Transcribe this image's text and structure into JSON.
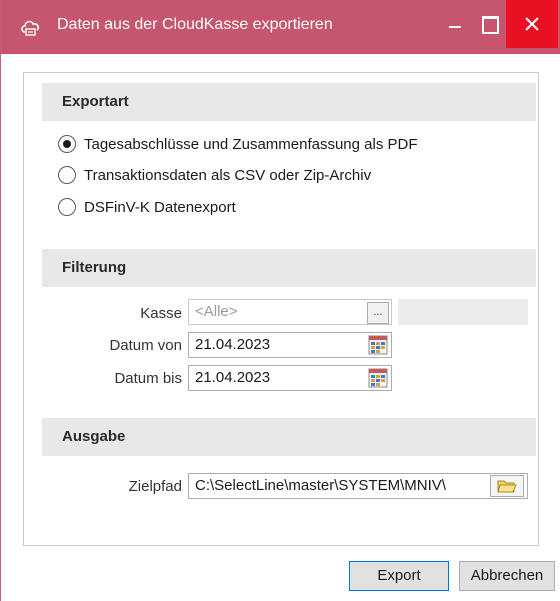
{
  "window": {
    "title": "Daten aus der CloudKasse exportieren",
    "icon": "cloud-register-icon",
    "accent_color": "#c5566e",
    "close_color": "#e81123"
  },
  "exportart": {
    "header": "Exportart",
    "options": [
      {
        "label": "Tagesabschlüsse und Zusammenfassung als PDF",
        "checked": true
      },
      {
        "label": "Transaktionsdaten als CSV oder Zip-Archiv",
        "checked": false
      },
      {
        "label": "DSFinV-K Datenexport",
        "checked": false
      }
    ]
  },
  "filterung": {
    "header": "Filterung",
    "kasse_label": "Kasse",
    "kasse_value": "<Alle>",
    "kasse_button": "...",
    "datum_von_label": "Datum von",
    "datum_von_value": "21.04.2023",
    "datum_bis_label": "Datum bis",
    "datum_bis_value": "21.04.2023"
  },
  "ausgabe": {
    "header": "Ausgabe",
    "zielpfad_label": "Zielpfad",
    "zielpfad_value": "C:\\SelectLine\\master\\SYSTEM\\MNIV\\"
  },
  "buttons": {
    "export": "Export",
    "cancel": "Abbrechen"
  }
}
